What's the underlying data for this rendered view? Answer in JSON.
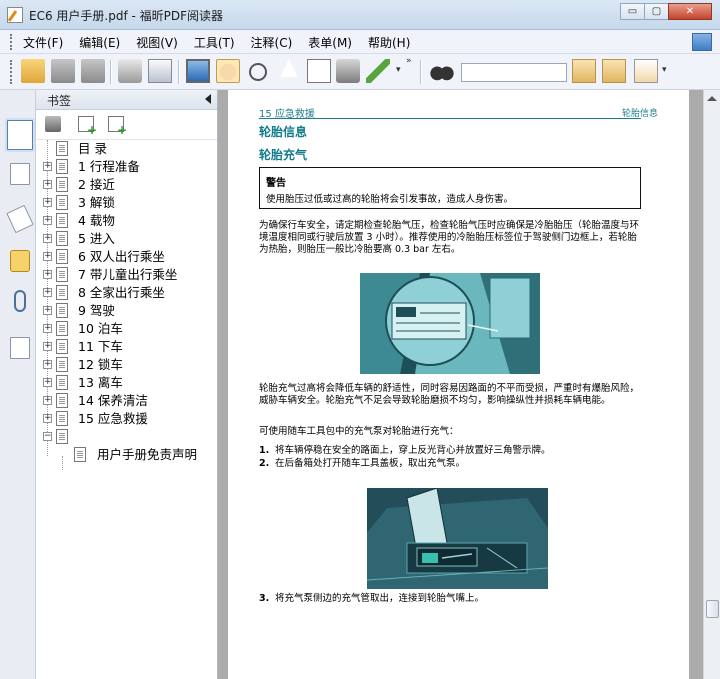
{
  "window": {
    "title": "EC6 用户手册.pdf - 福昕PDF阅读器",
    "minimize": "▭",
    "maximize": "▢",
    "close": "✕"
  },
  "menu": [
    "文件(F)",
    "编辑(E)",
    "视图(V)",
    "工具(T)",
    "注释(C)",
    "表单(M)",
    "帮助(H)"
  ],
  "toolbar": {
    "icons": [
      "open-folder",
      "save",
      "save-all",
      "print",
      "scan",
      "monitor",
      "hand",
      "zoom-glass",
      "select-cursor",
      "text-note",
      "snapshot-camera",
      "pen",
      "binoculars",
      "prev-result",
      "next-result",
      "hourglass"
    ],
    "overflow": "»",
    "dropdown": "▾",
    "search_value": ""
  },
  "bookmarks": {
    "title": "书签",
    "items": [
      {
        "label": "目 录",
        "expandable": false
      },
      {
        "label": "1  行程准备",
        "expandable": true
      },
      {
        "label": "2  接近",
        "expandable": true
      },
      {
        "label": "3  解锁",
        "expandable": true
      },
      {
        "label": "4  载物",
        "expandable": true
      },
      {
        "label": "5  进入",
        "expandable": true
      },
      {
        "label": "6  双人出行乘坐",
        "expandable": true
      },
      {
        "label": "7  带儿童出行乘坐",
        "expandable": true
      },
      {
        "label": "8  全家出行乘坐",
        "expandable": true
      },
      {
        "label": "9  驾驶",
        "expandable": true
      },
      {
        "label": "10  泊车",
        "expandable": true
      },
      {
        "label": "11  下车",
        "expandable": true
      },
      {
        "label": "12  锁车",
        "expandable": true
      },
      {
        "label": "13  离车",
        "expandable": true
      },
      {
        "label": "14  保养清洁",
        "expandable": true
      },
      {
        "label": "15  应急救援",
        "expandable": true
      },
      {
        "label": "",
        "expandable": true,
        "expanded": true
      },
      {
        "label": "用户手册免责声明",
        "expandable": false,
        "child": true
      }
    ]
  },
  "page": {
    "header_left": "15  应急救援",
    "header_right": "轮胎信息",
    "h1": "轮胎信息",
    "h2": "轮胎充气",
    "warning_title": "警告",
    "warning_text": "使用胎压过低或过高的轮胎将会引发事故，造成人身伤害。",
    "para1": "为确保行车安全，请定期检查轮胎气压，检查轮胎气压时应确保是冷胎胎压（轮胎温度与环境温度相同或行驶后放置 3 小时）。推荐使用的冷胎胎压标签位于驾驶侧门边框上，若轮胎为热胎，则胎压一般比冷胎要高 0.3 bar 左右。",
    "para2": "轮胎充气过高将会降低车辆的舒适性，同时容易因路面的不平而受损，严重时有爆胎风险，威胁车辆安全。轮胎充气不足会导致轮胎磨损不均匀，影响操纵性并损耗车辆电能。",
    "para3": "可使用随车工具包中的充气泵对轮胎进行充气：",
    "steps": [
      {
        "n": "1.",
        "t": "将车辆停稳在安全的路面上，穿上反光背心并放置好三角警示牌。"
      },
      {
        "n": "2.",
        "t": "在后备箱处打开随车工具盖板，取出充气泵。"
      },
      {
        "n": "3.",
        "t": "将充气泵侧边的充气管取出，连接到轮胎气嘴上。"
      }
    ]
  },
  "colors": {
    "accent_teal": "#117c8b",
    "figure_teal": "#5aa9b1",
    "figure_dark": "#234e59"
  }
}
